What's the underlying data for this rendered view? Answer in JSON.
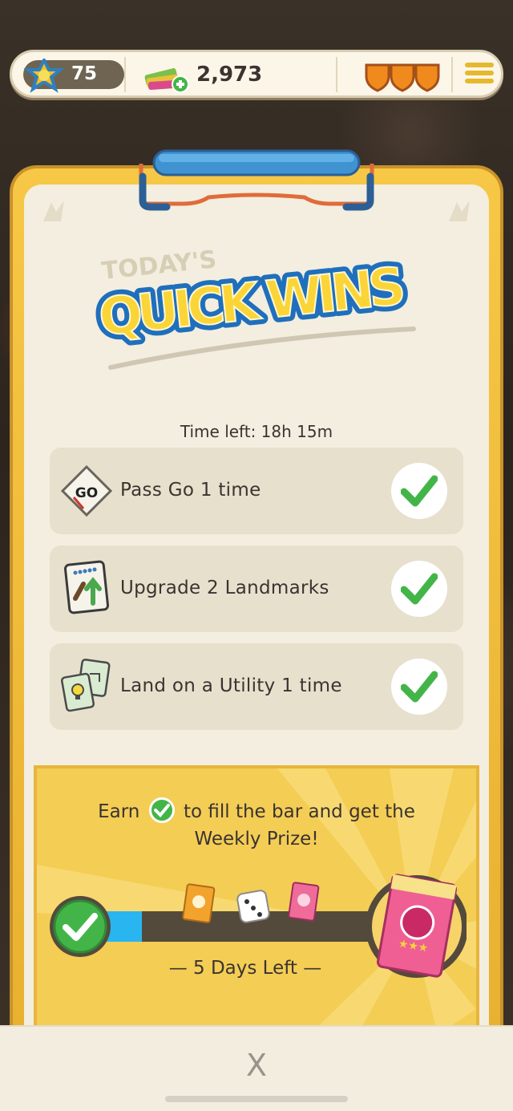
{
  "topbar": {
    "level": "75",
    "cash": "2,973",
    "shields": 3
  },
  "logo": {
    "prefix": "TODAY'S",
    "title": "QUICK WINS"
  },
  "time_left": "Time left: 18h 15m",
  "tasks": [
    {
      "label": "Pass Go 1 time",
      "icon": "go-tile-icon",
      "completed": true
    },
    {
      "label": "Upgrade 2 Landmarks",
      "icon": "landmark-upgrade-icon",
      "completed": true
    },
    {
      "label": "Land on a Utility 1 time",
      "icon": "utility-cards-icon",
      "completed": true
    }
  ],
  "prize": {
    "text_before": "Earn",
    "text_after": "to fill the bar and get the",
    "text_line2": "Weekly Prize!",
    "days_left": "— 5 Days Left —",
    "progress_fraction": 0.15
  },
  "bottom": {
    "close_label": "X"
  },
  "colors": {
    "accent_yellow": "#f4cd55",
    "check_green": "#43b548",
    "progress_blue": "#29b6f0",
    "shield_orange": "#f08a1c"
  }
}
